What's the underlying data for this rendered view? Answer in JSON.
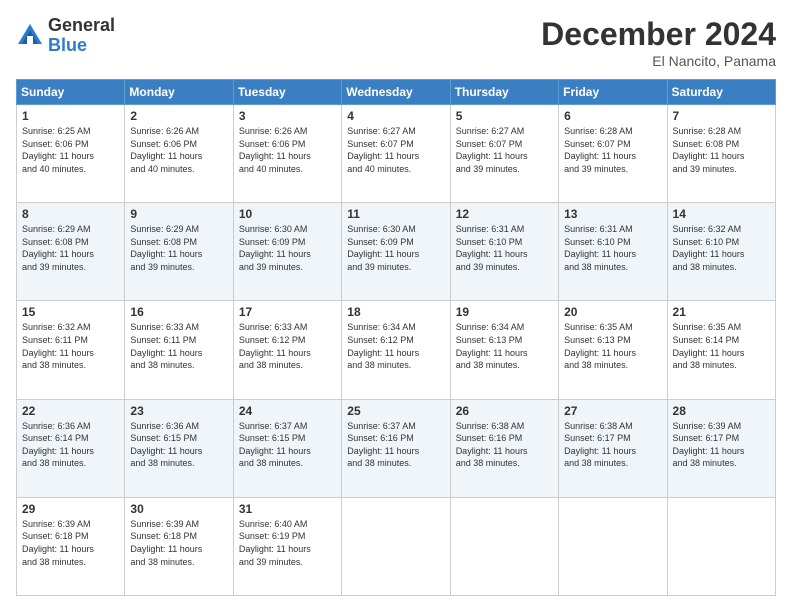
{
  "logo": {
    "general": "General",
    "blue": "Blue"
  },
  "title": "December 2024",
  "location": "El Nancito, Panama",
  "days_of_week": [
    "Sunday",
    "Monday",
    "Tuesday",
    "Wednesday",
    "Thursday",
    "Friday",
    "Saturday"
  ],
  "weeks": [
    [
      {
        "day": "1",
        "info": "Sunrise: 6:25 AM\nSunset: 6:06 PM\nDaylight: 11 hours\nand 40 minutes."
      },
      {
        "day": "2",
        "info": "Sunrise: 6:26 AM\nSunset: 6:06 PM\nDaylight: 11 hours\nand 40 minutes."
      },
      {
        "day": "3",
        "info": "Sunrise: 6:26 AM\nSunset: 6:06 PM\nDaylight: 11 hours\nand 40 minutes."
      },
      {
        "day": "4",
        "info": "Sunrise: 6:27 AM\nSunset: 6:07 PM\nDaylight: 11 hours\nand 40 minutes."
      },
      {
        "day": "5",
        "info": "Sunrise: 6:27 AM\nSunset: 6:07 PM\nDaylight: 11 hours\nand 39 minutes."
      },
      {
        "day": "6",
        "info": "Sunrise: 6:28 AM\nSunset: 6:07 PM\nDaylight: 11 hours\nand 39 minutes."
      },
      {
        "day": "7",
        "info": "Sunrise: 6:28 AM\nSunset: 6:08 PM\nDaylight: 11 hours\nand 39 minutes."
      }
    ],
    [
      {
        "day": "8",
        "info": "Sunrise: 6:29 AM\nSunset: 6:08 PM\nDaylight: 11 hours\nand 39 minutes."
      },
      {
        "day": "9",
        "info": "Sunrise: 6:29 AM\nSunset: 6:08 PM\nDaylight: 11 hours\nand 39 minutes."
      },
      {
        "day": "10",
        "info": "Sunrise: 6:30 AM\nSunset: 6:09 PM\nDaylight: 11 hours\nand 39 minutes."
      },
      {
        "day": "11",
        "info": "Sunrise: 6:30 AM\nSunset: 6:09 PM\nDaylight: 11 hours\nand 39 minutes."
      },
      {
        "day": "12",
        "info": "Sunrise: 6:31 AM\nSunset: 6:10 PM\nDaylight: 11 hours\nand 39 minutes."
      },
      {
        "day": "13",
        "info": "Sunrise: 6:31 AM\nSunset: 6:10 PM\nDaylight: 11 hours\nand 38 minutes."
      },
      {
        "day": "14",
        "info": "Sunrise: 6:32 AM\nSunset: 6:10 PM\nDaylight: 11 hours\nand 38 minutes."
      }
    ],
    [
      {
        "day": "15",
        "info": "Sunrise: 6:32 AM\nSunset: 6:11 PM\nDaylight: 11 hours\nand 38 minutes."
      },
      {
        "day": "16",
        "info": "Sunrise: 6:33 AM\nSunset: 6:11 PM\nDaylight: 11 hours\nand 38 minutes."
      },
      {
        "day": "17",
        "info": "Sunrise: 6:33 AM\nSunset: 6:12 PM\nDaylight: 11 hours\nand 38 minutes."
      },
      {
        "day": "18",
        "info": "Sunrise: 6:34 AM\nSunset: 6:12 PM\nDaylight: 11 hours\nand 38 minutes."
      },
      {
        "day": "19",
        "info": "Sunrise: 6:34 AM\nSunset: 6:13 PM\nDaylight: 11 hours\nand 38 minutes."
      },
      {
        "day": "20",
        "info": "Sunrise: 6:35 AM\nSunset: 6:13 PM\nDaylight: 11 hours\nand 38 minutes."
      },
      {
        "day": "21",
        "info": "Sunrise: 6:35 AM\nSunset: 6:14 PM\nDaylight: 11 hours\nand 38 minutes."
      }
    ],
    [
      {
        "day": "22",
        "info": "Sunrise: 6:36 AM\nSunset: 6:14 PM\nDaylight: 11 hours\nand 38 minutes."
      },
      {
        "day": "23",
        "info": "Sunrise: 6:36 AM\nSunset: 6:15 PM\nDaylight: 11 hours\nand 38 minutes."
      },
      {
        "day": "24",
        "info": "Sunrise: 6:37 AM\nSunset: 6:15 PM\nDaylight: 11 hours\nand 38 minutes."
      },
      {
        "day": "25",
        "info": "Sunrise: 6:37 AM\nSunset: 6:16 PM\nDaylight: 11 hours\nand 38 minutes."
      },
      {
        "day": "26",
        "info": "Sunrise: 6:38 AM\nSunset: 6:16 PM\nDaylight: 11 hours\nand 38 minutes."
      },
      {
        "day": "27",
        "info": "Sunrise: 6:38 AM\nSunset: 6:17 PM\nDaylight: 11 hours\nand 38 minutes."
      },
      {
        "day": "28",
        "info": "Sunrise: 6:39 AM\nSunset: 6:17 PM\nDaylight: 11 hours\nand 38 minutes."
      }
    ],
    [
      {
        "day": "29",
        "info": "Sunrise: 6:39 AM\nSunset: 6:18 PM\nDaylight: 11 hours\nand 38 minutes."
      },
      {
        "day": "30",
        "info": "Sunrise: 6:39 AM\nSunset: 6:18 PM\nDaylight: 11 hours\nand 38 minutes."
      },
      {
        "day": "31",
        "info": "Sunrise: 6:40 AM\nSunset: 6:19 PM\nDaylight: 11 hours\nand 39 minutes."
      },
      {
        "day": "",
        "info": ""
      },
      {
        "day": "",
        "info": ""
      },
      {
        "day": "",
        "info": ""
      },
      {
        "day": "",
        "info": ""
      }
    ]
  ]
}
